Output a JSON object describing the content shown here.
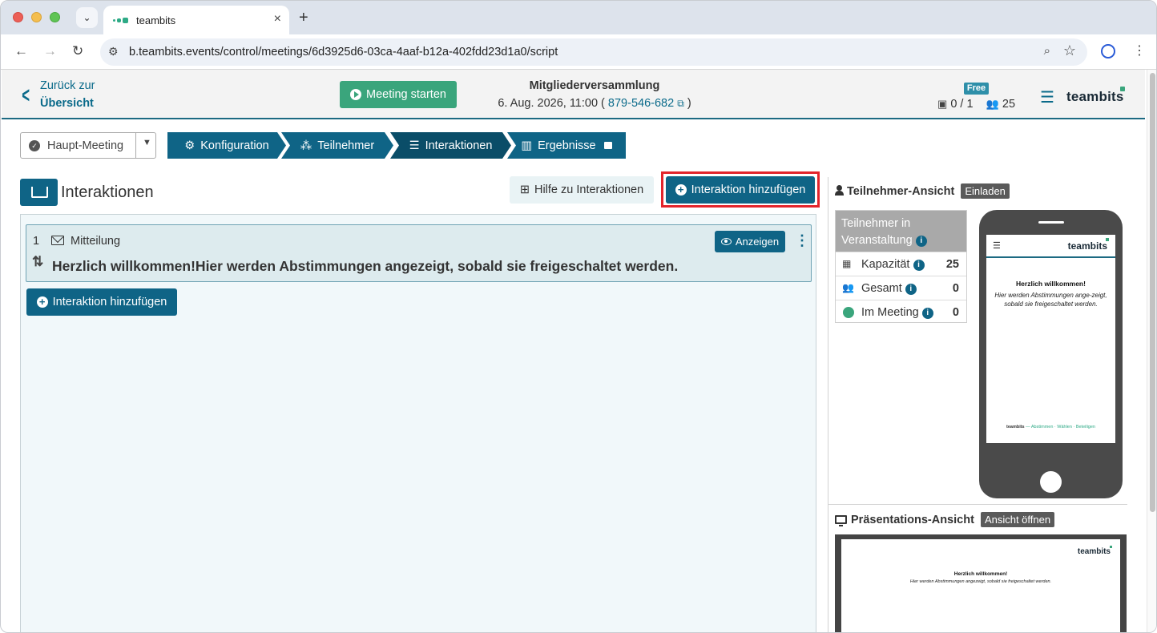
{
  "browser": {
    "tab_title": "teambits",
    "url": "b.teambits.events/control/meetings/6d3925d6-03ca-4aaf-b12a-402fdd23d1a0/script"
  },
  "header": {
    "back_line1": "Zurück zur",
    "back_line2": "Übersicht",
    "start_button": "Meeting starten",
    "meeting_title": "Mitgliederversammlung",
    "meeting_date": "6. Aug. 2026, 11:00 (",
    "meeting_code": "879-546-682",
    "meeting_close": ")",
    "plan_badge": "Free",
    "seats": "0 / 1",
    "participants": "25",
    "logo": "teambits"
  },
  "steps": {
    "meeting_select": "Haupt-Meeting",
    "items": [
      {
        "label": "Konfiguration"
      },
      {
        "label": "Teilnehmer"
      },
      {
        "label": "Interaktionen"
      },
      {
        "label": "Ergebnisse"
      }
    ]
  },
  "section": {
    "title": "Interaktionen",
    "help_button": "Hilfe zu Interaktionen",
    "add_button": "Interaktion hinzufügen"
  },
  "interactions": [
    {
      "number": "1",
      "type": "Mitteilung",
      "text": "Herzlich willkommen!Hier werden Abstimmungen angezeigt, sobald sie freigeschaltet werden.",
      "show_button": "Anzeigen"
    }
  ],
  "add_bottom_button": "Interaktion hinzufügen",
  "participant_view": {
    "title": "Teilnehmer-Ansicht",
    "invite_badge": "Einladen",
    "table_head": "Teilnehmer in Veranstaltung",
    "rows": [
      {
        "label": "Kapazität",
        "value": "25"
      },
      {
        "label": "Gesamt",
        "value": "0"
      },
      {
        "label": "Im Meeting",
        "value": "0"
      }
    ],
    "phone": {
      "logo": "teambits",
      "headline": "Herzlich willkommen!",
      "body": "Hier werden Abstimmungen ange-zeigt, sobald sie freigeschaltet werden.",
      "footer_brand": "teambits",
      "footer_tagline": "— Abstimmen · Wählen · Beteiligen"
    }
  },
  "presentation_view": {
    "title": "Präsentations-Ansicht",
    "open_badge": "Ansicht öffnen",
    "logo": "teambits",
    "headline": "Herzlich willkommen!",
    "body": "Hier werden Abstimmungen angezeigt, sobald sie freigeschaltet werden."
  },
  "colors": {
    "primary": "#0f6486",
    "active_step": "#0a4d68",
    "success": "#3aa57c",
    "highlight": "#e3242b"
  }
}
